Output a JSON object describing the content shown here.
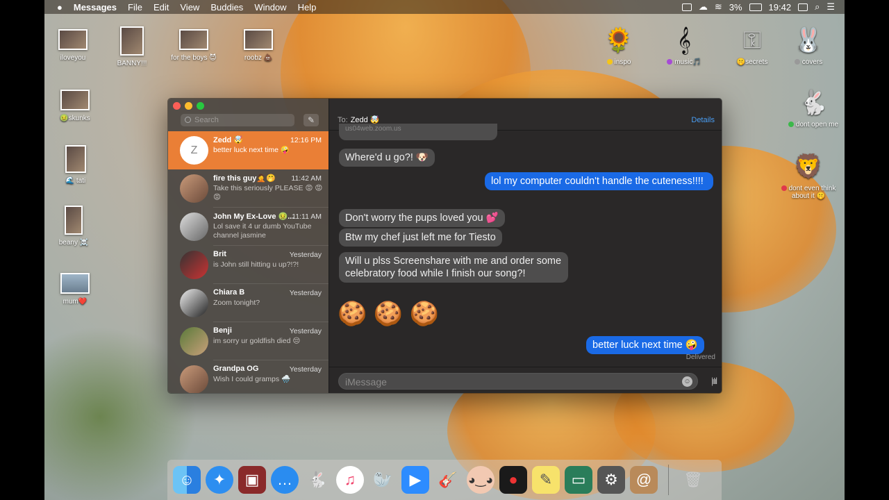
{
  "menubar": {
    "apple": "",
    "app": "Messages",
    "menus": [
      "File",
      "Edit",
      "View",
      "Buddies",
      "Window",
      "Help"
    ],
    "battery": "3%",
    "clock": "19:42"
  },
  "desktop": {
    "left_icons": [
      "iloveyou",
      "BANNY!!!",
      "for the boys 😈",
      "roobz 💩",
      "🤢skunks",
      "🌊 tati",
      "beany ☠️",
      "mum❤️"
    ],
    "right_icons": [
      "inspo",
      "music🎵",
      "🤫secrets",
      "covers",
      "dont open me",
      "dont even think about it 🤫"
    ]
  },
  "sidebar": {
    "search_placeholder": "Search",
    "compose_icon": "✎",
    "conversations": [
      {
        "avatar": "Z",
        "name": "Zedd 🤯",
        "time": "12:16 PM",
        "preview": "better luck next time 🤪"
      },
      {
        "name": "fire this guy🤦🤭",
        "time": "11:42 AM",
        "preview": "Take this seriously PLEASE 😡 😡😡"
      },
      {
        "name": "John My Ex-Love 🤢...",
        "time": "11:11 AM",
        "preview": "Lol save it 4 ur dumb YouTube channel jasmine"
      },
      {
        "name": "Brit",
        "time": "Yesterday",
        "preview": "is John still hitting u up?!?!"
      },
      {
        "name": "Chiara B",
        "time": "Yesterday",
        "preview": "Zoom tonight?"
      },
      {
        "name": "Benji",
        "time": "Yesterday",
        "preview": "im sorry ur goldfish died 😔"
      },
      {
        "name": "Grandpa OG",
        "time": "Yesterday",
        "preview": "Wish I could gramps 🌧️"
      }
    ]
  },
  "chat": {
    "to_label": "To:",
    "recipient": "Zedd 🤯",
    "details": "Details",
    "link_fragment": "us04web.zoom.us",
    "messages": [
      {
        "from": "them",
        "text": "Where'd u go?! 🐶"
      },
      {
        "from": "me",
        "text": "lol my computer couldn't handle the cuteness!!!!"
      },
      {
        "from": "them",
        "text": "Don't worry the pups loved you 💕"
      },
      {
        "from": "them",
        "text": "Btw my chef just left me for Tiesto"
      },
      {
        "from": "them",
        "text": "Will u plss Screenshare with me and order some celebratory food while I finish our song?!"
      },
      {
        "from": "them",
        "text": "🍪 🍪 🍪"
      },
      {
        "from": "me",
        "text": "better luck next time 🤪"
      }
    ],
    "status": "Delivered",
    "input_placeholder": "iMessage"
  }
}
